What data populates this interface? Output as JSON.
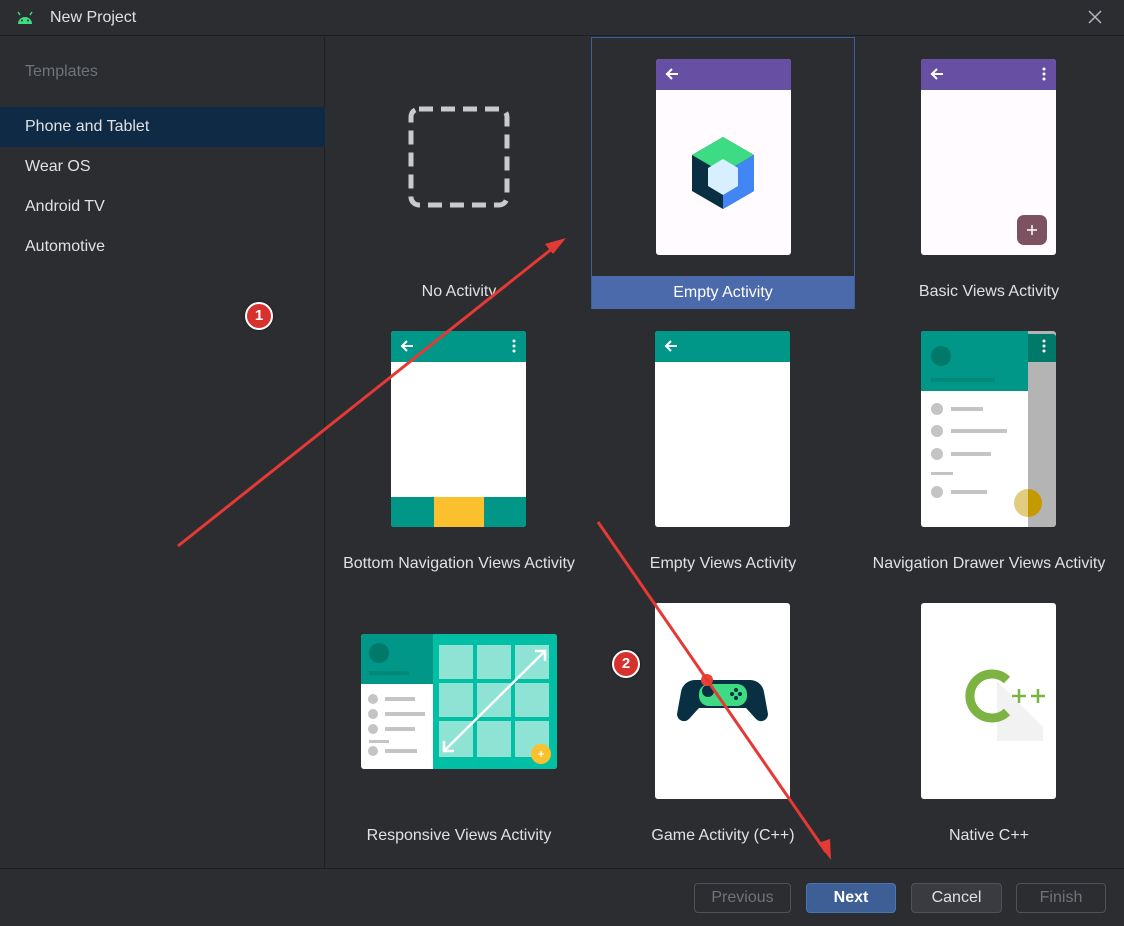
{
  "window": {
    "title": "New Project"
  },
  "sidebar": {
    "heading": "Templates",
    "items": [
      {
        "label": "Phone and Tablet",
        "selected": true
      },
      {
        "label": "Wear OS",
        "selected": false
      },
      {
        "label": "Android TV",
        "selected": false
      },
      {
        "label": "Automotive",
        "selected": false
      }
    ]
  },
  "templates": [
    {
      "label": "No Activity",
      "icon": "dashed-square-icon"
    },
    {
      "label": "Empty Activity",
      "icon": "compose-logo-icon",
      "selected": true
    },
    {
      "label": "Basic Views Activity",
      "icon": "phone-fab-icon"
    },
    {
      "label": "Bottom Navigation Views Activity",
      "icon": "phone-bottom-nav-icon"
    },
    {
      "label": "Empty Views Activity",
      "icon": "phone-empty-icon"
    },
    {
      "label": "Navigation Drawer Views Activity",
      "icon": "phone-drawer-icon"
    },
    {
      "label": "Responsive Views Activity",
      "icon": "tablet-grid-icon"
    },
    {
      "label": "Game Activity (C++)",
      "icon": "gamepad-icon"
    },
    {
      "label": "Native C++",
      "icon": "cpp-logo-icon"
    }
  ],
  "footer": {
    "previous": "Previous",
    "next": "Next",
    "cancel": "Cancel",
    "finish": "Finish"
  },
  "annotations": {
    "badge1": "1",
    "badge2": "2"
  },
  "colors": {
    "background": "#2b2d30",
    "selection": "#0e2a44",
    "tile_selected": "#4a6aac",
    "purple_appbar": "#6750a4",
    "teal_appbar": "#009688",
    "accent_red": "#e53935"
  }
}
